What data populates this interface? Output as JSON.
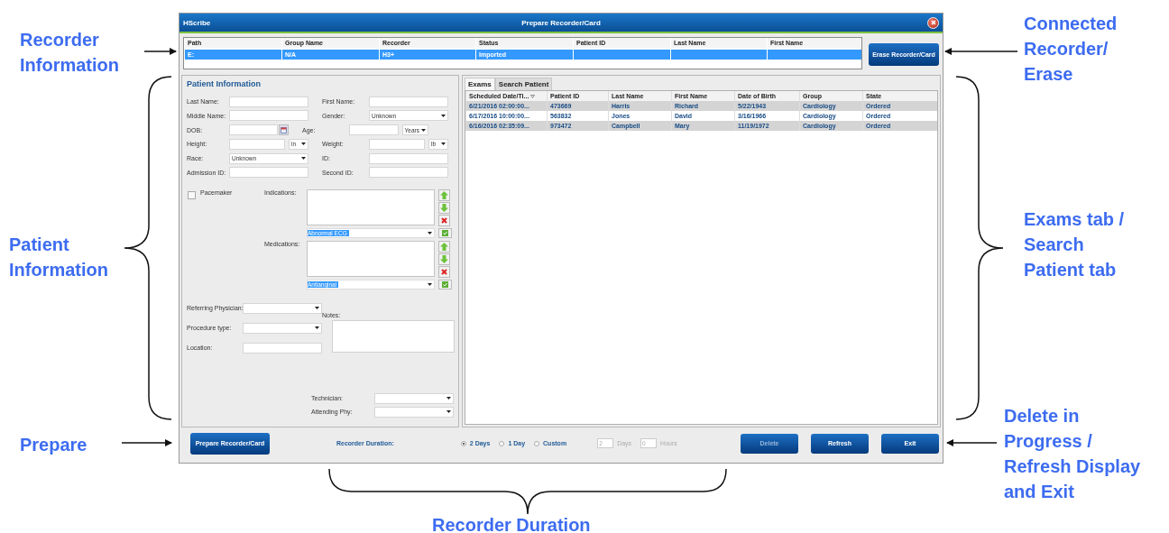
{
  "window": {
    "app": "HScribe",
    "title": "Prepare Recorder/Card"
  },
  "recorder_table": {
    "columns": [
      "Path",
      "Group Name",
      "Recorder",
      "Status",
      "Patient ID",
      "Last Name",
      "First Name"
    ],
    "rows": [
      {
        "cells": [
          "E:",
          "N/A",
          "H3+",
          "Imported"
        ],
        "selected": true
      }
    ]
  },
  "erase_button": "Erase Recorder/Card",
  "patient_info": {
    "title": "Patient Information",
    "rows": [
      {
        "left": {
          "label": "Last Name:",
          "kind": "text"
        },
        "right": {
          "label": "First Name:",
          "kind": "text"
        }
      },
      {
        "left": {
          "label": "Middle Name:",
          "kind": "text"
        },
        "right": {
          "label": "Gender:",
          "kind": "select",
          "value": "Unknown"
        }
      },
      {
        "left": {
          "label": "DOB:",
          "kind": "date"
        },
        "right": {
          "label": "Age:",
          "kind": "number_unit",
          "unit": "Years"
        }
      },
      {
        "left": {
          "label": "Height:",
          "kind": "number_unit",
          "unit": "in"
        },
        "right": {
          "label": "Weight:",
          "kind": "number_unit",
          "unit": "lb"
        }
      },
      {
        "left": {
          "label": "Race:",
          "kind": "select",
          "value": "Unknown"
        },
        "right": {
          "label": "ID:",
          "kind": "text"
        }
      },
      {
        "left": {
          "label": "Admission ID:",
          "kind": "text"
        },
        "right": {
          "label": "Second ID:",
          "kind": "text"
        }
      }
    ],
    "pacemaker": {
      "label": "Pacemaker",
      "checked": false
    },
    "lists": [
      {
        "label": "Indications:",
        "option": "Abnormal ECG"
      },
      {
        "label": "Medications:",
        "option": "Antianginal"
      }
    ],
    "lower_fields": [
      {
        "label": "Referring Physician:",
        "kind": "select"
      },
      {
        "label": "Procedure type:",
        "kind": "select"
      },
      {
        "label": "Location:",
        "kind": "text"
      }
    ],
    "notes_label": "Notes:",
    "staff_fields": [
      {
        "label": "Technician:",
        "kind": "select"
      },
      {
        "label": "Attending Phy:",
        "kind": "select"
      }
    ]
  },
  "tabs": [
    {
      "label": "Exams",
      "selected": true
    },
    {
      "label": "Search Patient",
      "selected": false
    }
  ],
  "exams_table": {
    "columns": [
      {
        "label": "Scheduled Date/Ti...",
        "sorted": true
      },
      {
        "label": "Patient ID",
        "sorted": false
      },
      {
        "label": "Last Name",
        "sorted": false
      },
      {
        "label": "First Name",
        "sorted": false
      },
      {
        "label": "Date of Birth",
        "sorted": false
      },
      {
        "label": "Group",
        "sorted": false
      },
      {
        "label": "State",
        "sorted": false
      }
    ],
    "rows": [
      {
        "cells": [
          "6/21/2016 02:00:00...",
          "473669",
          "Harris",
          "Richard",
          "5/22/1943",
          "Cardiology",
          "Ordered"
        ]
      },
      {
        "cells": [
          "6/17/2016 10:00:00...",
          "563832",
          "Jones",
          "David",
          "3/16/1966",
          "Cardiology",
          "Ordered"
        ]
      },
      {
        "cells": [
          "6/16/2016 02:35:09...",
          "973472",
          "Campbell",
          "Mary",
          "11/19/1972",
          "Cardiology",
          "Ordered"
        ]
      }
    ]
  },
  "bottom": {
    "prepare_button": "Prepare Recorder/Card",
    "duration_label": "Recorder Duration:",
    "radios": [
      {
        "label": "2 Days",
        "selected": true
      },
      {
        "label": "1 Day",
        "selected": false
      },
      {
        "label": "Custom",
        "selected": false
      }
    ],
    "spinners": [
      {
        "value": "2",
        "unit": "Days",
        "disabled": true
      },
      {
        "value": "0",
        "unit": "Hours",
        "disabled": true
      }
    ],
    "buttons": [
      {
        "label": "Delete",
        "disabled": true
      },
      {
        "label": "Refresh",
        "disabled": false
      },
      {
        "label": "Exit",
        "disabled": false
      }
    ]
  },
  "callouts": [
    {
      "text": "Recorder\nInformation"
    },
    {
      "text": "Patient\nInformation"
    },
    {
      "text": "Prepare"
    },
    {
      "text": "Connected\nRecorder/\nErase"
    },
    {
      "text": "Exams tab /\nSearch\nPatient tab"
    },
    {
      "text": "Delete in\nProgress /\nRefresh Display\nand Exit"
    },
    {
      "text": "Recorder Duration"
    }
  ]
}
